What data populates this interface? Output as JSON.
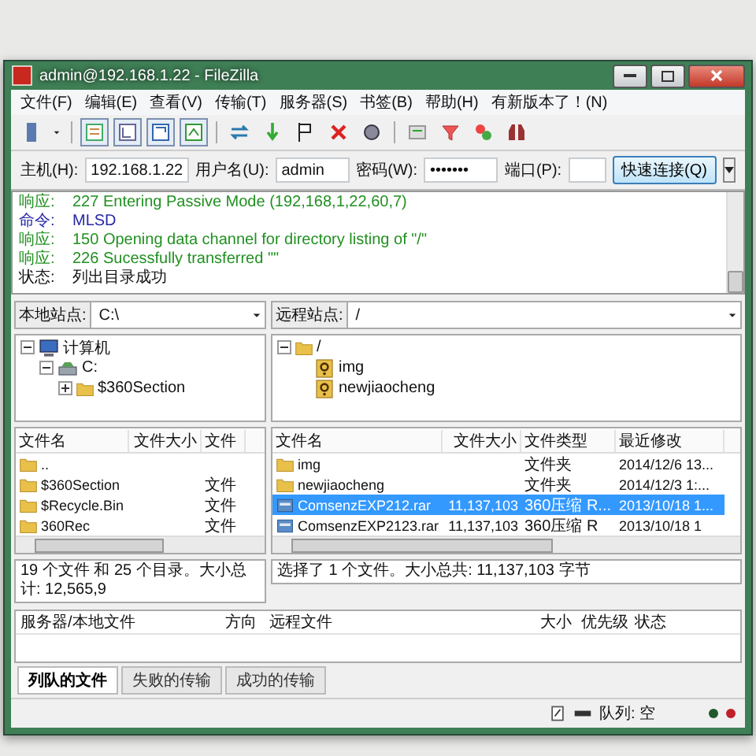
{
  "window": {
    "title": "admin@192.168.1.22 - FileZilla"
  },
  "menu": [
    "文件(F)",
    "编辑(E)",
    "查看(V)",
    "传输(T)",
    "服务器(S)",
    "书签(B)",
    "帮助(H)",
    "有新版本了！(N)"
  ],
  "quickconnect": {
    "fields": [
      {
        "label": "主机(H):",
        "value": "192.168.1.22",
        "kind": "text"
      },
      {
        "label": "用户名(U):",
        "value": "admin",
        "kind": "text"
      },
      {
        "label": "密码(W):",
        "value": "•••••••",
        "kind": "text"
      },
      {
        "label": "端口(P):",
        "kind": "port"
      }
    ],
    "button": "快速连接(Q)"
  },
  "log": [
    {
      "kind": "response",
      "label": "响应:",
      "text": "227 Entering Passive Mode (192,168,1,22,60,7)"
    },
    {
      "kind": "command",
      "label": "命令:",
      "text": "MLSD"
    },
    {
      "kind": "response",
      "label": "响应:",
      "text": "150 Opening data channel for directory listing of \"/\""
    },
    {
      "kind": "response",
      "label": "响应:",
      "text": "226 Sucessfully transferred \"\""
    },
    {
      "kind": "status",
      "label": "状态:",
      "text": "列出目录成功"
    }
  ],
  "local": {
    "site_label": "本地站点:",
    "path": "C:\\",
    "tree": [
      {
        "name": "计算机",
        "kind": "computer",
        "expanded": true,
        "children": [
          {
            "name": "C:",
            "kind": "drive",
            "expanded": true,
            "children": [
              {
                "name": "$360Section",
                "kind": "folder",
                "expanded": false
              }
            ]
          }
        ]
      }
    ],
    "columns": [
      "文件名",
      "文件大小",
      "文件"
    ],
    "rows": [
      {
        "name": "..",
        "kind": "folder",
        "selected": false
      },
      {
        "name": "$360Section",
        "kind": "folder",
        "type": "文件",
        "selected": false
      },
      {
        "name": "$Recycle.Bin",
        "kind": "folder",
        "type": "文件",
        "selected": false
      },
      {
        "name": "360Rec",
        "kind": "folder",
        "type": "文件",
        "selected": false
      }
    ],
    "status": "19 个文件 和 25 个目录。大小总计: 12,565,9"
  },
  "remote": {
    "site_label": "远程站点:",
    "path": "/",
    "tree": [
      {
        "name": "/",
        "kind": "folder",
        "expanded": true,
        "children": [
          {
            "name": "img",
            "kind": "unknown"
          },
          {
            "name": "newjiaocheng",
            "kind": "unknown"
          }
        ]
      }
    ],
    "columns": [
      "文件名",
      "文件大小",
      "文件类型",
      "最近修改"
    ],
    "rows": [
      {
        "name": "img",
        "kind": "folder",
        "type": "文件夹",
        "modified": "2014/12/6 13...",
        "selected": false
      },
      {
        "name": "newjiaocheng",
        "kind": "folder",
        "type": "文件夹",
        "modified": "2014/12/3 1:...",
        "selected": false
      },
      {
        "name": "ComsenzEXP212.rar",
        "kind": "archive",
        "size": "11,137,103",
        "type": "360压缩 R...",
        "modified": "2013/10/18 1...",
        "selected": true
      },
      {
        "name": "ComsenzEXP2123.rar",
        "kind": "archive",
        "size": "11,137,103",
        "type": "360压缩 R",
        "modified": "2013/10/18 1",
        "selected": false
      }
    ],
    "status": "选择了 1 个文件。大小总共: 11,137,103 字节"
  },
  "queue": {
    "columns": [
      "服务器/本地文件",
      "方向",
      "远程文件",
      "大小",
      "优先级",
      "状态"
    ],
    "tabs": [
      {
        "label": "列队的文件",
        "selected": true
      },
      {
        "label": "失败的传输",
        "selected": false
      },
      {
        "label": "成功的传输",
        "selected": false
      }
    ]
  },
  "status_bar": {
    "text": "队列: 空",
    "lights": [
      {
        "color": "#1f5a2a"
      },
      {
        "color": "#c0202a"
      }
    ]
  }
}
